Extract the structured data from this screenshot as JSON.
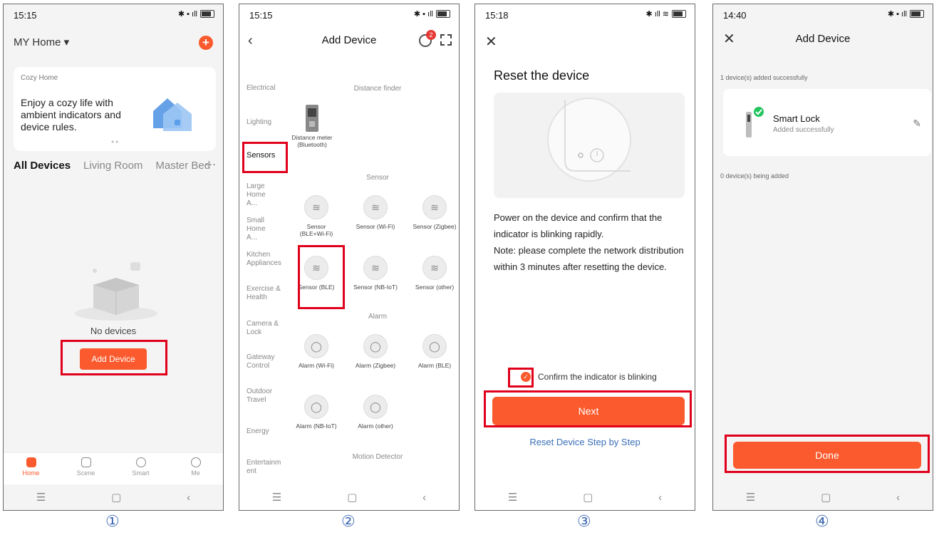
{
  "step_labels": [
    "①",
    "②",
    "③",
    "④"
  ],
  "accent_color": "#fa5a2d",
  "highlight_color": "#e0001b",
  "system_nav": {
    "menu": "☰",
    "home": "▢",
    "back": "‹"
  },
  "panel1": {
    "time": "15:15",
    "home_label": "MY Home ▾",
    "plus_icon": "+",
    "card_label": "Cozy Home",
    "card_text": "Enjoy a cozy life with ambient indicators and device rules.",
    "tabs": [
      "All Devices",
      "Living Room",
      "Master Bed"
    ],
    "more": "···",
    "no_devices": "No devices",
    "add_device_button": "Add Device",
    "bottom_tabs": [
      "Home",
      "Scene",
      "Smart",
      "Me"
    ]
  },
  "panel2": {
    "time": "15:15",
    "title": "Add Device",
    "badge_count": "2",
    "categories": [
      "Electrical",
      "Lighting",
      "Sensors",
      "Large Home A...",
      "Small Home A...",
      "Kitchen Appliances",
      "Exercise & Health",
      "Camera & Lock",
      "Gateway Control",
      "Outdoor Travel",
      "Energy",
      "Entertainm ent"
    ],
    "sections": {
      "distance": "Distance finder",
      "sensor": "Sensor",
      "alarm": "Alarm",
      "motion": "Motion Detector"
    },
    "distance_device": "Distance meter (Bluetooth)",
    "sensors": [
      "Sensor (BLE+Wi-Fi)",
      "Sensor (Wi-Fi)",
      "Sensor (Zigbee)",
      "Sensor (BLE)",
      "Sensor (NB-IoT)",
      "Sensor (other)"
    ],
    "alarms": [
      "Alarm (Wi-Fi)",
      "Alarm (Zigbee)",
      "Alarm (BLE)",
      "Alarm (NB-IoT)",
      "Alarm (other)"
    ]
  },
  "panel3": {
    "time": "15:18",
    "close_icon": "✕",
    "heading": "Reset the device",
    "description": "Power on the device and confirm that the indicator is blinking rapidly.\nNote: please complete the network distribution within 3 minutes after resetting the device.",
    "confirm_checkbox": "Confirm the indicator is blinking",
    "next_button": "Next",
    "reset_link": "Reset Device Step by Step"
  },
  "panel4": {
    "time": "14:40",
    "close_icon": "✕",
    "title": "Add Device",
    "added_text": "1 device(s) added successfully",
    "device_name": "Smart Lock",
    "device_status": "Added successfully",
    "adding_text": "0 device(s) being added",
    "done_button": "Done"
  }
}
